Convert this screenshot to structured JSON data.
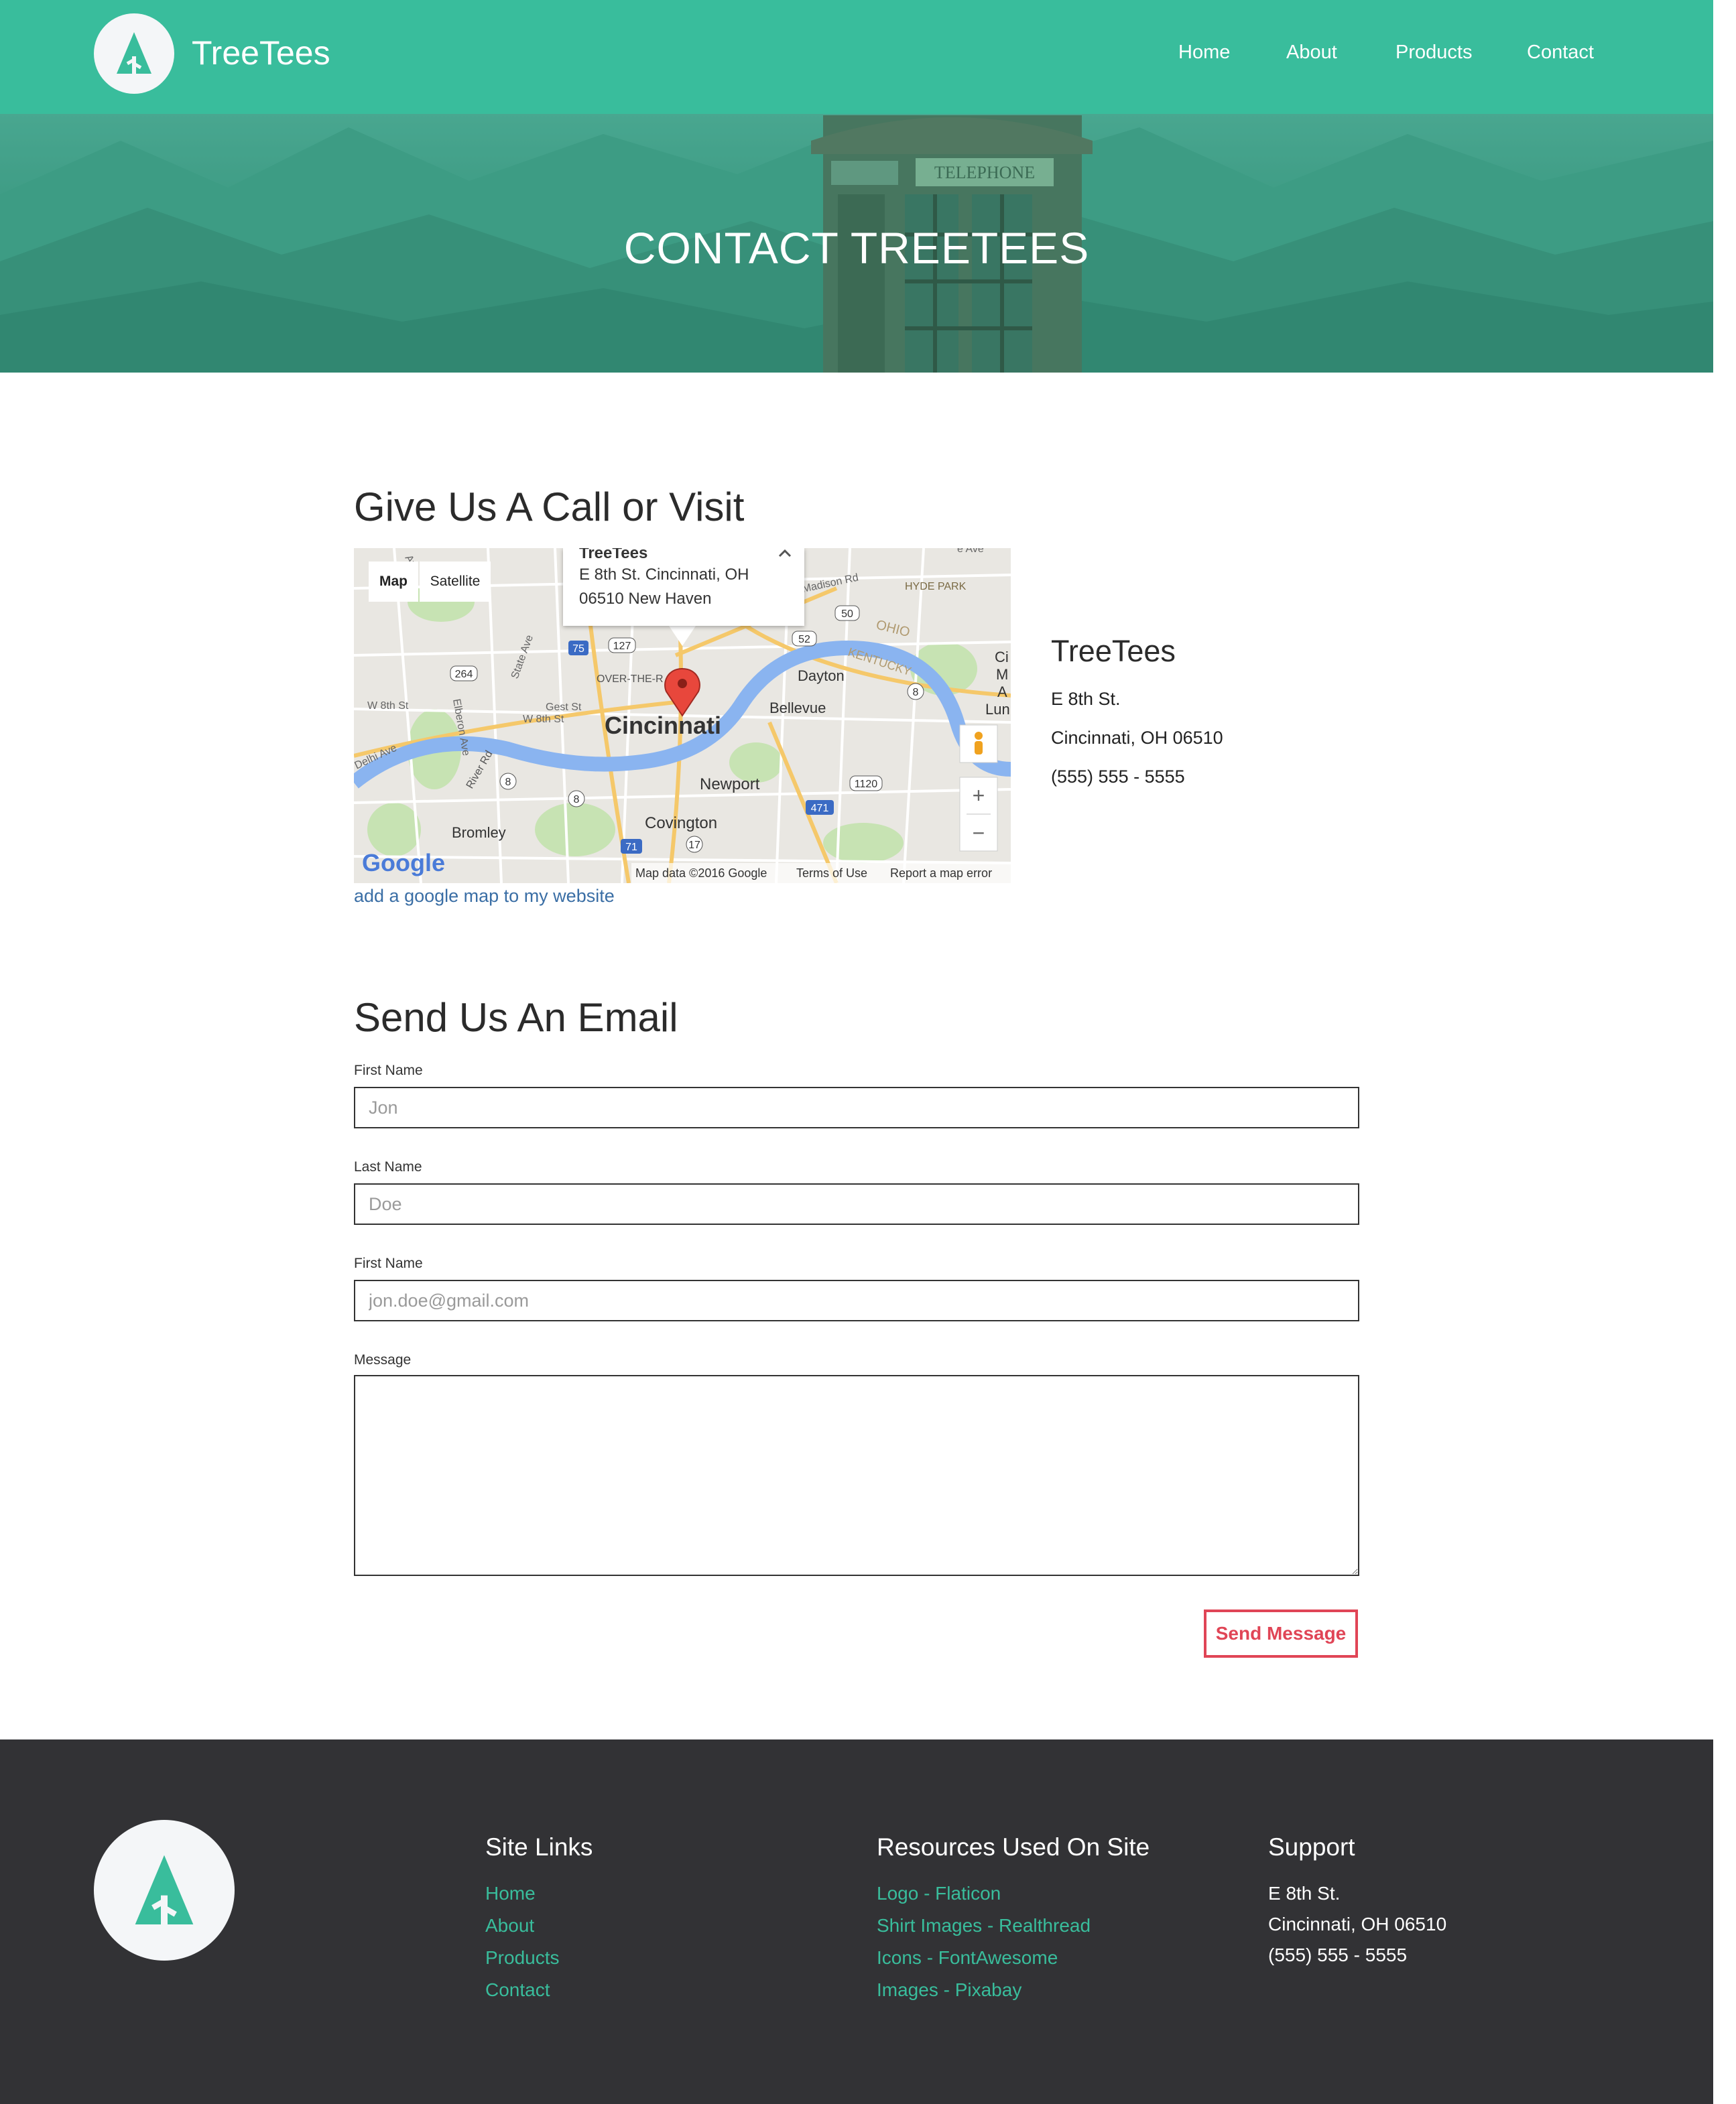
{
  "header": {
    "brand": "TreeTees",
    "nav": [
      "Home",
      "About",
      "Products",
      "Contact"
    ]
  },
  "hero": {
    "title": "CONTACT TREETEES",
    "booth_sign": "TELEPHONE"
  },
  "contact": {
    "heading": "Give Us A Call or Visit",
    "map": {
      "type_buttons": [
        "Map",
        "Satellite"
      ],
      "info_window": {
        "title": "TreeTees",
        "address_line1": "E 8th St. Cincinnati, OH",
        "address_line2": "06510 New Haven"
      },
      "labels": {
        "city": "Cincinnati",
        "over_the_rhine": "OVER-THE-R",
        "dayton": "Dayton",
        "bellevue": "Bellevue",
        "newport": "Newport",
        "covington": "Covington",
        "bromley": "Bromley",
        "hyde_park": "HYDE PARK",
        "ohio": "OHIO",
        "kentucky": "KENTUCKY",
        "madison": "Madison Rd",
        "w8th": "W 8th St",
        "w8th2": "W 8th St",
        "gest": "Gest St",
        "elberon": "Elberon Ave",
        "state": "State Ave",
        "river_rd": "River Rd",
        "delhi": "Delhi Ave",
        "cut1": "Ci",
        "cut2": "M",
        "cut3": "A",
        "cut4": "Lun",
        "cut5": "Ave",
        "cut6": "e Ave"
      },
      "route_shields": [
        "75",
        "127",
        "50",
        "52",
        "264",
        "8",
        "8",
        "8",
        "1120",
        "471",
        "71",
        "17"
      ],
      "attribution": "Map data ©2016 Google",
      "terms": "Terms of Use",
      "report": "Report a map error",
      "google_logo": "Google",
      "zoom_in": "+",
      "zoom_out": "−"
    },
    "map_link": "add a google map to my website",
    "address": {
      "name": "TreeTees",
      "street": "E 8th St.",
      "city": "Cincinnati, OH 06510",
      "phone": "(555) 555 - 5555"
    }
  },
  "email_form": {
    "heading": "Send Us An Email",
    "first_name_label": "First Name",
    "first_name_placeholder": "Jon",
    "last_name_label": "Last Name",
    "last_name_placeholder": "Doe",
    "email_label": "First Name",
    "email_placeholder": "jon.doe@gmail.com",
    "message_label": "Message",
    "send_button": "Send Message"
  },
  "footer": {
    "site_links": {
      "heading": "Site Links",
      "links": [
        "Home",
        "About",
        "Products",
        "Contact"
      ]
    },
    "resources": {
      "heading": "Resources Used On Site",
      "links": [
        "Logo - Flaticon",
        "Shirt Images - Realthread",
        "Icons - FontAwesome",
        "Images - Pixabay"
      ]
    },
    "support": {
      "heading": "Support",
      "street": "E 8th St.",
      "city": "Cincinnati, OH 06510",
      "phone": "(555) 555 - 5555"
    }
  },
  "colors": {
    "brand_green": "#39bd9c",
    "footer_bg": "#323235",
    "send_red": "#e04556",
    "link_blue": "#3a6ea5"
  }
}
